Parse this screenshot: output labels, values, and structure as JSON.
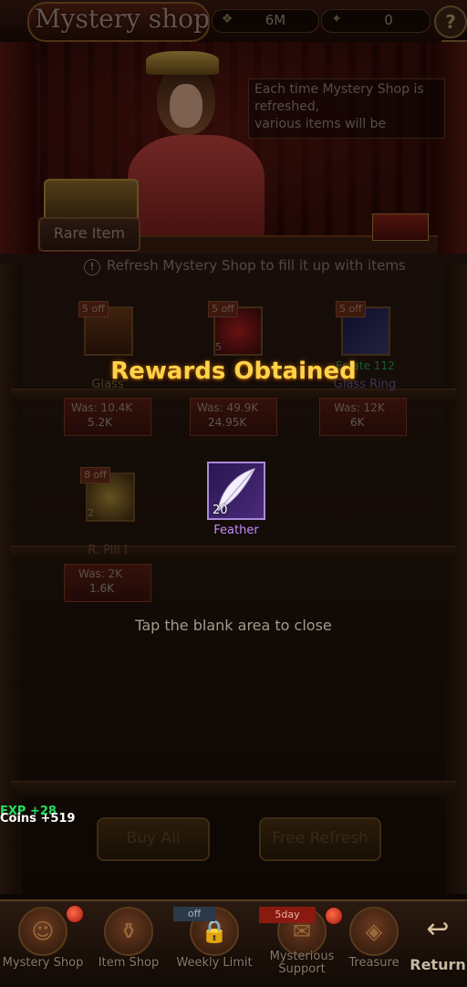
{
  "header": {
    "title": "Mystery shop",
    "resource1": {
      "icon": "coin-stack-icon",
      "value": "6M"
    },
    "resource2": {
      "icon": "gold-ingot-icon",
      "value": "0"
    },
    "help_label": "?",
    "close_label": "✕"
  },
  "banner": {
    "description": "Each time Mystery Shop is\nrefreshed,\n various items will be",
    "rare_button": "Rare Item"
  },
  "shop": {
    "info_icon": "!",
    "info": "Refresh Mystery Shop to fill it up with items",
    "items": [
      {
        "badge": "5 off",
        "name": "Glass",
        "qty": "",
        "was": "Was:  10.4K",
        "now": "5.2K"
      },
      {
        "badge": "5 off",
        "name": "",
        "qty": "5",
        "was": "Was:  49.9K",
        "now": "24.95K"
      },
      {
        "badge": "5 off",
        "name": "Glass Ring",
        "qty": "",
        "was": "Was:  12K",
        "now": "6K"
      },
      {
        "badge": "8 off",
        "name": "R. Pill I",
        "qty": "2",
        "was": "Was:  2K",
        "now": "1.6K"
      }
    ],
    "item3_extra": "Estate 112"
  },
  "rewards": {
    "title": "Rewards Obtained",
    "item": {
      "name": "Feather",
      "qty": "20",
      "icon": "feather-icon"
    },
    "tap_close": "Tap the blank area to close"
  },
  "floating": {
    "exp": "EXP +28",
    "coins": "Coins  +519"
  },
  "buttons": {
    "buy_all": "Buy All",
    "free_refresh": "Free Refresh"
  },
  "nav": {
    "items": [
      {
        "label": "Mystery Shop",
        "icon": "merchant-icon"
      },
      {
        "label": "Item Shop",
        "icon": "item-shop-icon"
      },
      {
        "label": "Weekly Limit",
        "icon": "lock-icon"
      },
      {
        "label": "Mysterious Support",
        "icon": "support-icon"
      },
      {
        "label": "Treasure",
        "icon": "treasure-icon"
      },
      {
        "label": "Return",
        "icon": "return-arrow-icon"
      }
    ],
    "weekly_tag": "off",
    "support_tag": "5day"
  }
}
